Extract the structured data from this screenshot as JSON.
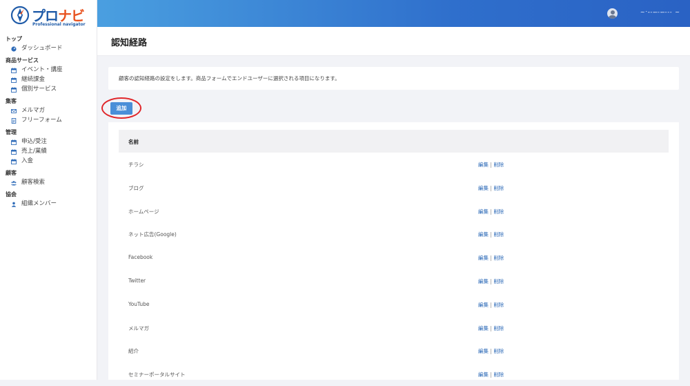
{
  "logo": {
    "brand_main": "プロ",
    "brand_accent": "ナビ",
    "tagline": "Professional navigator"
  },
  "sidebar": {
    "sections": [
      {
        "title": "トップ",
        "items": [
          {
            "label": "ダッシュボード",
            "icon": "dashboard-icon"
          }
        ]
      },
      {
        "title": "商品サービス",
        "items": [
          {
            "label": "イベント・講座",
            "icon": "calendar-icon"
          },
          {
            "label": "継続課金",
            "icon": "calendar-icon"
          },
          {
            "label": "個別サービス",
            "icon": "calendar-icon"
          }
        ]
      },
      {
        "title": "集客",
        "items": [
          {
            "label": "メルマガ",
            "icon": "envelope-icon"
          },
          {
            "label": "フリーフォーム",
            "icon": "document-icon"
          }
        ]
      },
      {
        "title": "管理",
        "items": [
          {
            "label": "申込/受注",
            "icon": "calendar-icon"
          },
          {
            "label": "売上/業績",
            "icon": "calendar-icon"
          },
          {
            "label": "入金",
            "icon": "calendar-icon"
          }
        ]
      },
      {
        "title": "顧客",
        "items": [
          {
            "label": "顧客検索",
            "icon": "users-icon"
          }
        ]
      },
      {
        "title": "協会",
        "items": [
          {
            "label": "組織メンバー",
            "icon": "user-icon"
          }
        ]
      }
    ]
  },
  "header": {
    "user_name": "~ˑ ̵̵ ̵ ̵ ̶ ̵ ̵ ̶  ̵ ̵ ̵ ~"
  },
  "page": {
    "title": "認知経路",
    "description": "顧客の認知経路の設定をします。商品フォームでエンドユーザーに選択される項目になります。",
    "add_label": "追加"
  },
  "table": {
    "header_name": "名前",
    "edit_label": "編集",
    "separator": "|",
    "delete_label": "削除",
    "rows": [
      {
        "name": "チラシ"
      },
      {
        "name": "ブログ"
      },
      {
        "name": "ホームページ"
      },
      {
        "name": "ネット広告(Google)"
      },
      {
        "name": "Facebook"
      },
      {
        "name": "Twitter"
      },
      {
        "name": "YouTube"
      },
      {
        "name": "メルマガ"
      },
      {
        "name": "紹介"
      },
      {
        "name": "セミナーポータルサイト"
      }
    ]
  },
  "colors": {
    "header_start": "#4a9fe0",
    "header_end": "#2a62c4",
    "accent": "#4a8fd8",
    "link": "#2e6bb8",
    "highlight": "#e0262a",
    "brand": "#1f5ba8",
    "brand_accent": "#e8521f"
  }
}
